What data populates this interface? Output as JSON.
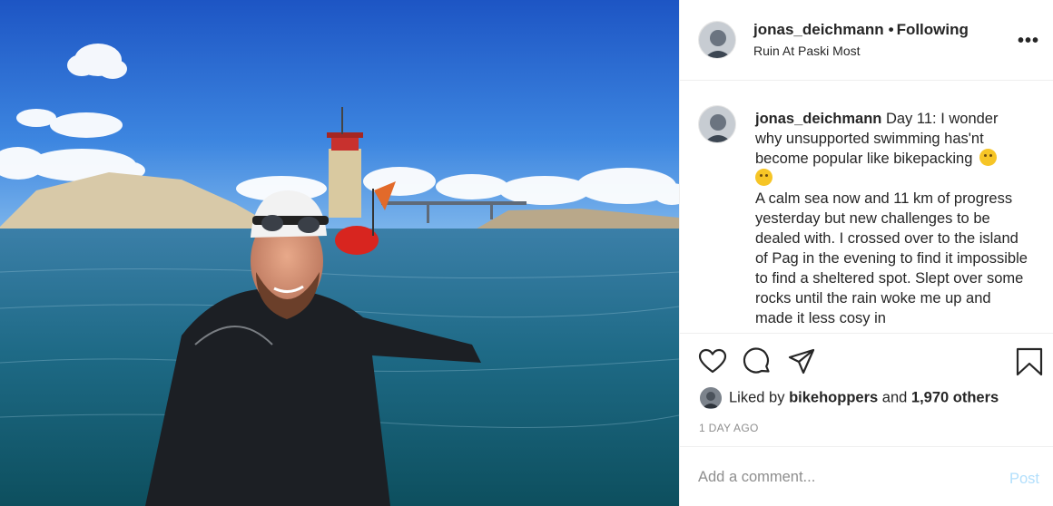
{
  "header": {
    "username": "jonas_deichmann",
    "separator": "•",
    "follow_status": "Following",
    "location": "Ruin At Paski Most",
    "more_icon": "more-horizontal-icon"
  },
  "caption": {
    "username": "jonas_deichmann",
    "line1": "Day 11: I wonder why unsupported swimming has'nt become popular like bikepacking",
    "line2": "A calm sea now and 11 km of progress yesterday but new challenges to be dealed with. I crossed over to the island of Pag in the evening to find it impossible to find a sheltered spot. Slept over some rocks until the rain woke me up and made it less cosy in"
  },
  "actions": {
    "like_icon": "heart-icon",
    "comment_icon": "comment-icon",
    "share_icon": "share-icon",
    "save_icon": "bookmark-icon"
  },
  "likes": {
    "prefix": "Liked by",
    "user": "bikehoppers",
    "joiner": "and",
    "count": "1,970 others"
  },
  "date": "1 DAY AGO",
  "comment": {
    "placeholder": "Add a comment...",
    "post_label": "Post"
  },
  "colors": {
    "post_disabled": "#b2dffc",
    "text": "#262626",
    "muted": "#8e8e8e",
    "border": "#efefef"
  }
}
